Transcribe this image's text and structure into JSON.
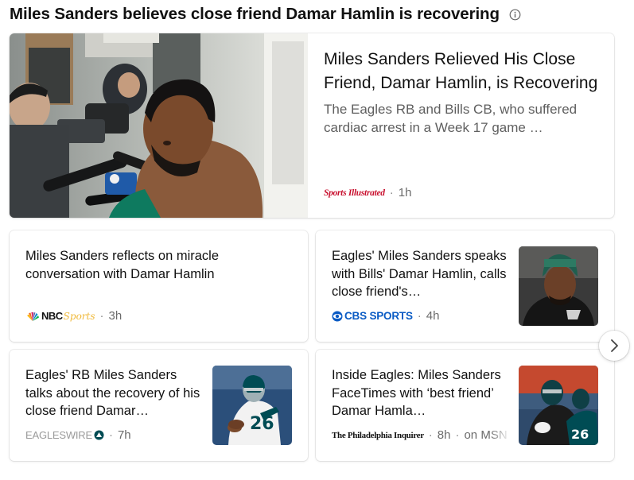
{
  "header": {
    "title": "Miles Sanders believes close friend Damar Hamlin is recovering",
    "info_icon": "info-icon"
  },
  "hero": {
    "title": "Miles Sanders Relieved His Close Friend, Damar Hamlin, is Recovering",
    "snippet": "The Eagles RB and Bills CB, who suffered cardiac arrest in a Week 17 game …",
    "source": "Sports Illustrated",
    "source_color": "#c8102e",
    "time": "1h"
  },
  "cards": [
    {
      "title": "Miles Sanders reflects on miracle conversation with Damar Hamlin",
      "source": "NBC Sports",
      "source_word": "NBC",
      "source_script": "Sports",
      "time": "3h"
    },
    {
      "title": "Eagles' Miles Sanders speaks with Bills' Damar Hamlin, calls close friend's…",
      "source": "CBS SPORTS",
      "source_color": "#0a5bc4",
      "time": "4h"
    },
    {
      "title": "Eagles' RB Miles Sanders talks about the recovery of his close friend Damar…",
      "source": "EAGLESWIRE",
      "time": "7h"
    },
    {
      "title": "Inside Eagles: Miles Sanders FaceTimes with ‘best friend’ Damar Hamla…",
      "source": "The Philadelphia Inquirer",
      "time": "8h",
      "extra": "on MSN"
    }
  ],
  "navigation": {
    "next_icon": "chevron-right-icon"
  },
  "colors": {
    "nbc_peacock": [
      "#fcb711",
      "#f37021",
      "#cc004c",
      "#6460aa",
      "#0089d0",
      "#0db14b"
    ],
    "eagles_green": "#004c54",
    "bills_blue": "#00338d"
  }
}
